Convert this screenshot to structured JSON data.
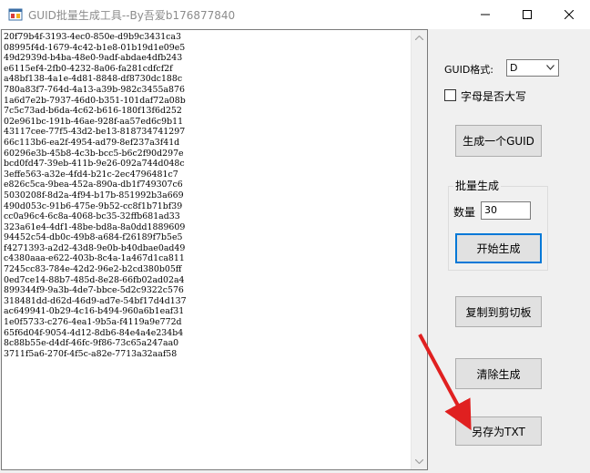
{
  "window": {
    "title": "GUID批量生成工具--By吾爱b176877840"
  },
  "output": {
    "guids": [
      "20f79b4f-3193-4ec0-850e-d9b9c3431ca3",
      "08995f4d-1679-4c42-b1e8-01b19d1e09e5",
      "49d2939d-b4ba-48e0-9adf-abdae4dfb243",
      "e6115ef4-2fb0-4232-8a06-fa281cdfcf2f",
      "a48bf138-4a1e-4d81-8848-df8730dc188c",
      "780a83f7-764d-4a13-a39b-982c3455a876",
      "1a6d7e2b-7937-46d0-b351-101daf72a08b",
      "7c5c73ad-b6da-4c62-b616-180f13f6d252",
      "02e961bc-191b-46ae-928f-aa57ed6c9b11",
      "43117cee-77f5-43d2-be13-818734741297",
      "66c113b6-ea2f-4954-ad79-8ef237a3f41d",
      "60296e3b-45b8-4c3b-bcc5-b6c2f90d297e",
      "bcd0fd47-39eb-411b-9e26-092a744d048c",
      "3effe563-a32e-4fd4-b21c-2ec4796481c7",
      "e826c5ca-9bea-452a-890a-db1f749307c6",
      "5030208f-8d2a-4f94-b17b-851992b3a669",
      "490d053c-91b6-475e-9b52-cc8f1b71bf39",
      "cc0a96c4-6c8a-4068-bc35-32ffb681ad33",
      "323a61e4-4df1-48be-bd8a-8a0dd1889609",
      "94452c54-db0c-49b8-a684-f26189f7b5e5",
      "f4271393-a2d2-43d8-9e0b-b40dbae0ad49",
      "c4380aaa-e622-403b-8c4a-1a467d1ca811",
      "7245cc83-784e-42d2-96e2-b2cd380b05ff",
      "0ed7ce14-88b7-485d-8e28-66fb02ad02a4",
      "899344f9-9a3b-4de7-bbce-5d2c9322c576",
      "318481dd-d62d-46d9-ad7e-54bf17d4d137",
      "ac649941-0b29-4c16-b494-960a6b1eaf31",
      "1e0f5733-c276-4ea1-9b5a-f4119a9e772d",
      "65f6d04f-9054-4d12-8db6-84e4a4e234b4",
      "8c88b55e-d4df-46fc-9f86-73c65a247aa0",
      "3711f5a6-270f-4f5c-a82e-7713a32aaf58"
    ]
  },
  "controls": {
    "format_label": "GUID格式:",
    "format_value": "D",
    "uppercase_label": "字母是否大写",
    "uppercase_checked": false,
    "generate_one_button": "生成一个GUID",
    "batch_group_title": "批量生成",
    "quantity_label": "数量",
    "quantity_value": "30",
    "start_button": "开始生成",
    "copy_button": "复制到剪切板",
    "clear_button": "清除生成",
    "save_button": "另存为TXT"
  },
  "colors": {
    "annotation_arrow": "#e02020",
    "focus_border": "#0078d7"
  }
}
